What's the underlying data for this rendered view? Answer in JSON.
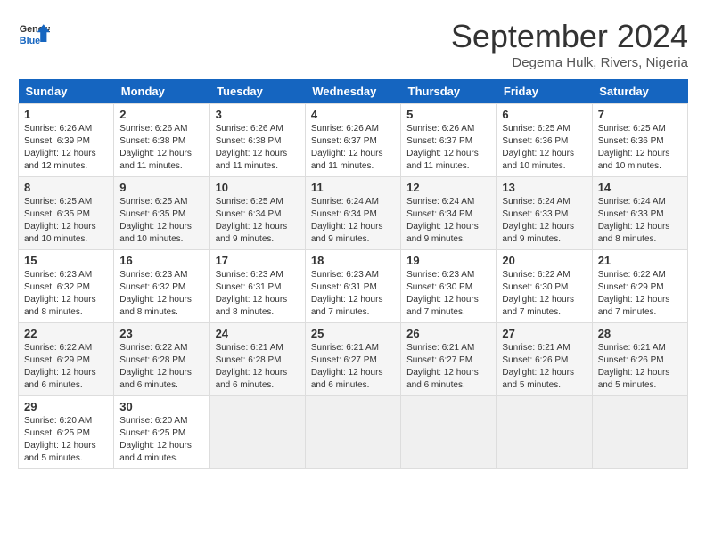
{
  "header": {
    "logo_general": "General",
    "logo_blue": "Blue",
    "month_title": "September 2024",
    "subtitle": "Degema Hulk, Rivers, Nigeria"
  },
  "calendar": {
    "days_of_week": [
      "Sunday",
      "Monday",
      "Tuesday",
      "Wednesday",
      "Thursday",
      "Friday",
      "Saturday"
    ],
    "weeks": [
      [
        {
          "day": "1",
          "sunrise": "6:26 AM",
          "sunset": "6:39 PM",
          "daylight": "12 hours and 12 minutes."
        },
        {
          "day": "2",
          "sunrise": "6:26 AM",
          "sunset": "6:38 PM",
          "daylight": "12 hours and 11 minutes."
        },
        {
          "day": "3",
          "sunrise": "6:26 AM",
          "sunset": "6:38 PM",
          "daylight": "12 hours and 11 minutes."
        },
        {
          "day": "4",
          "sunrise": "6:26 AM",
          "sunset": "6:37 PM",
          "daylight": "12 hours and 11 minutes."
        },
        {
          "day": "5",
          "sunrise": "6:26 AM",
          "sunset": "6:37 PM",
          "daylight": "12 hours and 11 minutes."
        },
        {
          "day": "6",
          "sunrise": "6:25 AM",
          "sunset": "6:36 PM",
          "daylight": "12 hours and 10 minutes."
        },
        {
          "day": "7",
          "sunrise": "6:25 AM",
          "sunset": "6:36 PM",
          "daylight": "12 hours and 10 minutes."
        }
      ],
      [
        {
          "day": "8",
          "sunrise": "6:25 AM",
          "sunset": "6:35 PM",
          "daylight": "12 hours and 10 minutes."
        },
        {
          "day": "9",
          "sunrise": "6:25 AM",
          "sunset": "6:35 PM",
          "daylight": "12 hours and 10 minutes."
        },
        {
          "day": "10",
          "sunrise": "6:25 AM",
          "sunset": "6:34 PM",
          "daylight": "12 hours and 9 minutes."
        },
        {
          "day": "11",
          "sunrise": "6:24 AM",
          "sunset": "6:34 PM",
          "daylight": "12 hours and 9 minutes."
        },
        {
          "day": "12",
          "sunrise": "6:24 AM",
          "sunset": "6:34 PM",
          "daylight": "12 hours and 9 minutes."
        },
        {
          "day": "13",
          "sunrise": "6:24 AM",
          "sunset": "6:33 PM",
          "daylight": "12 hours and 9 minutes."
        },
        {
          "day": "14",
          "sunrise": "6:24 AM",
          "sunset": "6:33 PM",
          "daylight": "12 hours and 8 minutes."
        }
      ],
      [
        {
          "day": "15",
          "sunrise": "6:23 AM",
          "sunset": "6:32 PM",
          "daylight": "12 hours and 8 minutes."
        },
        {
          "day": "16",
          "sunrise": "6:23 AM",
          "sunset": "6:32 PM",
          "daylight": "12 hours and 8 minutes."
        },
        {
          "day": "17",
          "sunrise": "6:23 AM",
          "sunset": "6:31 PM",
          "daylight": "12 hours and 8 minutes."
        },
        {
          "day": "18",
          "sunrise": "6:23 AM",
          "sunset": "6:31 PM",
          "daylight": "12 hours and 7 minutes."
        },
        {
          "day": "19",
          "sunrise": "6:23 AM",
          "sunset": "6:30 PM",
          "daylight": "12 hours and 7 minutes."
        },
        {
          "day": "20",
          "sunrise": "6:22 AM",
          "sunset": "6:30 PM",
          "daylight": "12 hours and 7 minutes."
        },
        {
          "day": "21",
          "sunrise": "6:22 AM",
          "sunset": "6:29 PM",
          "daylight": "12 hours and 7 minutes."
        }
      ],
      [
        {
          "day": "22",
          "sunrise": "6:22 AM",
          "sunset": "6:29 PM",
          "daylight": "12 hours and 6 minutes."
        },
        {
          "day": "23",
          "sunrise": "6:22 AM",
          "sunset": "6:28 PM",
          "daylight": "12 hours and 6 minutes."
        },
        {
          "day": "24",
          "sunrise": "6:21 AM",
          "sunset": "6:28 PM",
          "daylight": "12 hours and 6 minutes."
        },
        {
          "day": "25",
          "sunrise": "6:21 AM",
          "sunset": "6:27 PM",
          "daylight": "12 hours and 6 minutes."
        },
        {
          "day": "26",
          "sunrise": "6:21 AM",
          "sunset": "6:27 PM",
          "daylight": "12 hours and 6 minutes."
        },
        {
          "day": "27",
          "sunrise": "6:21 AM",
          "sunset": "6:26 PM",
          "daylight": "12 hours and 5 minutes."
        },
        {
          "day": "28",
          "sunrise": "6:21 AM",
          "sunset": "6:26 PM",
          "daylight": "12 hours and 5 minutes."
        }
      ],
      [
        {
          "day": "29",
          "sunrise": "6:20 AM",
          "sunset": "6:25 PM",
          "daylight": "12 hours and 5 minutes."
        },
        {
          "day": "30",
          "sunrise": "6:20 AM",
          "sunset": "6:25 PM",
          "daylight": "12 hours and 4 minutes."
        },
        null,
        null,
        null,
        null,
        null
      ]
    ]
  }
}
